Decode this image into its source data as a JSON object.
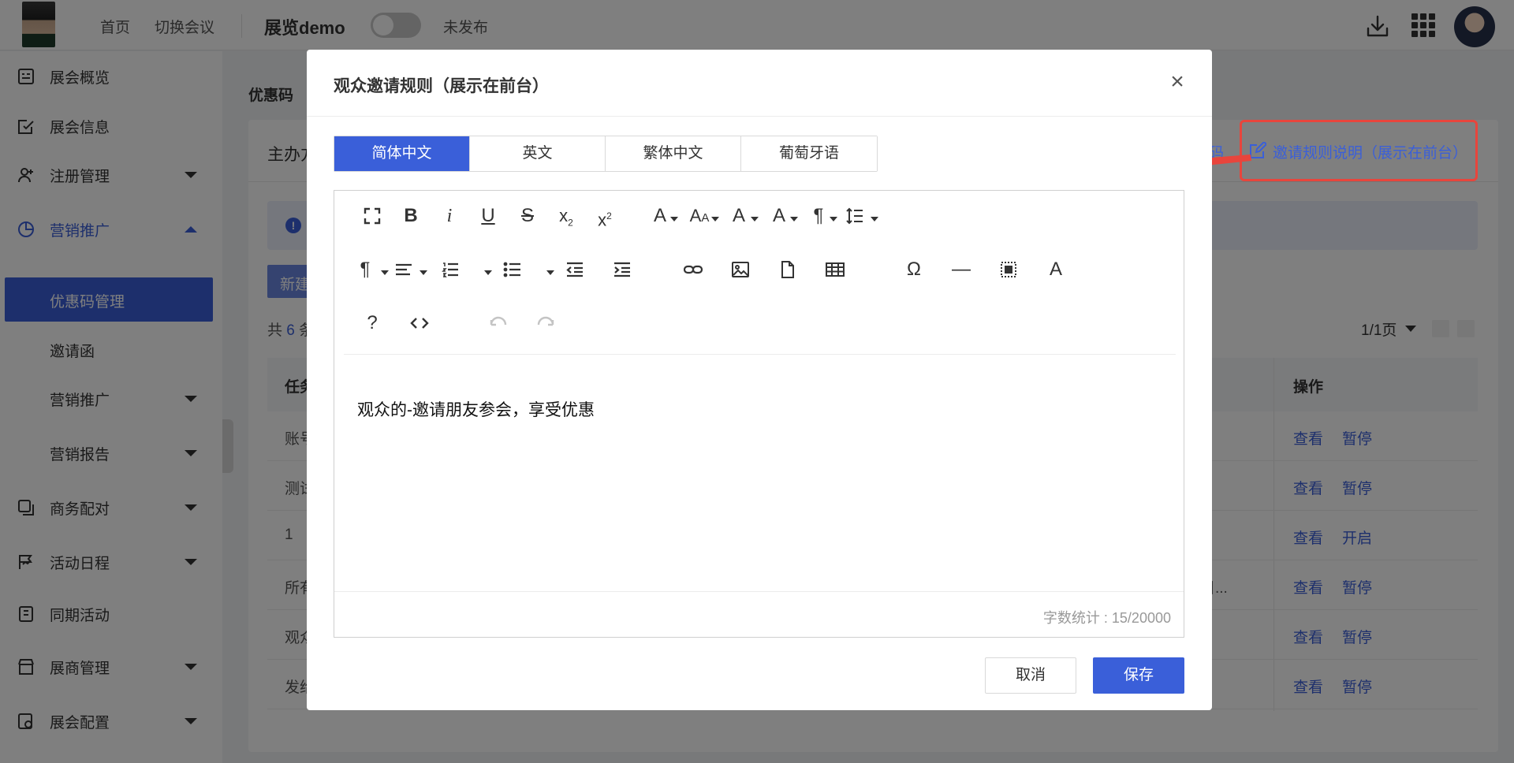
{
  "topbar": {
    "nav_home": "首页",
    "nav_switch": "切换会议",
    "event_title": "展览demo",
    "publish_status": "未发布"
  },
  "sidebar": {
    "items": [
      {
        "label": "展会概览"
      },
      {
        "label": "展会信息"
      },
      {
        "label": "注册管理"
      },
      {
        "label": "营销推广"
      },
      {
        "label": "优惠码管理"
      },
      {
        "label": "邀请函"
      },
      {
        "label": "营销推广"
      },
      {
        "label": "营销报告"
      },
      {
        "label": "商务配对"
      },
      {
        "label": "活动日程"
      },
      {
        "label": "同期活动"
      },
      {
        "label": "展商管理"
      },
      {
        "label": "展会配置"
      }
    ]
  },
  "main": {
    "page_title": "优惠码",
    "organizer": "主办方",
    "partial_link": "码",
    "rule_link": "邀请规则说明（展示在前台）",
    "new_button": "新建",
    "total_prefix": "共",
    "total_count": "6",
    "total_suffix": "条",
    "pager": "1/1页",
    "table": {
      "first_col_header": "任务",
      "ops_header": "操作",
      "rows": [
        {
          "first": "账号",
          "trail": "",
          "view": "查看",
          "toggle": "暂停"
        },
        {
          "first": "测试",
          "trail": "",
          "view": "查看",
          "toggle": "暂停"
        },
        {
          "first": "1",
          "trail": "",
          "view": "查看",
          "toggle": "开启"
        },
        {
          "first": "所有",
          "trail": "目...",
          "view": "查看",
          "toggle": "暂停"
        },
        {
          "first": "观众",
          "trail": "",
          "view": "查看",
          "toggle": "暂停"
        },
        {
          "first": "发给",
          "trail": "",
          "view": "查看",
          "toggle": "暂停"
        }
      ]
    }
  },
  "modal": {
    "title": "观众邀请规则（展示在前台）",
    "tabs": [
      "简体中文",
      "英文",
      "繁体中文",
      "葡萄牙语"
    ],
    "active_tab": "简体中文",
    "toolbar_help": "?",
    "editor_content": "观众的-邀请朋友参会，享受优惠",
    "word_count": "字数统计 : 15/20000",
    "cancel_label": "取消",
    "save_label": "保存"
  },
  "colors": {
    "primary": "#3a5fd9",
    "annotation_red": "#e8453c"
  }
}
